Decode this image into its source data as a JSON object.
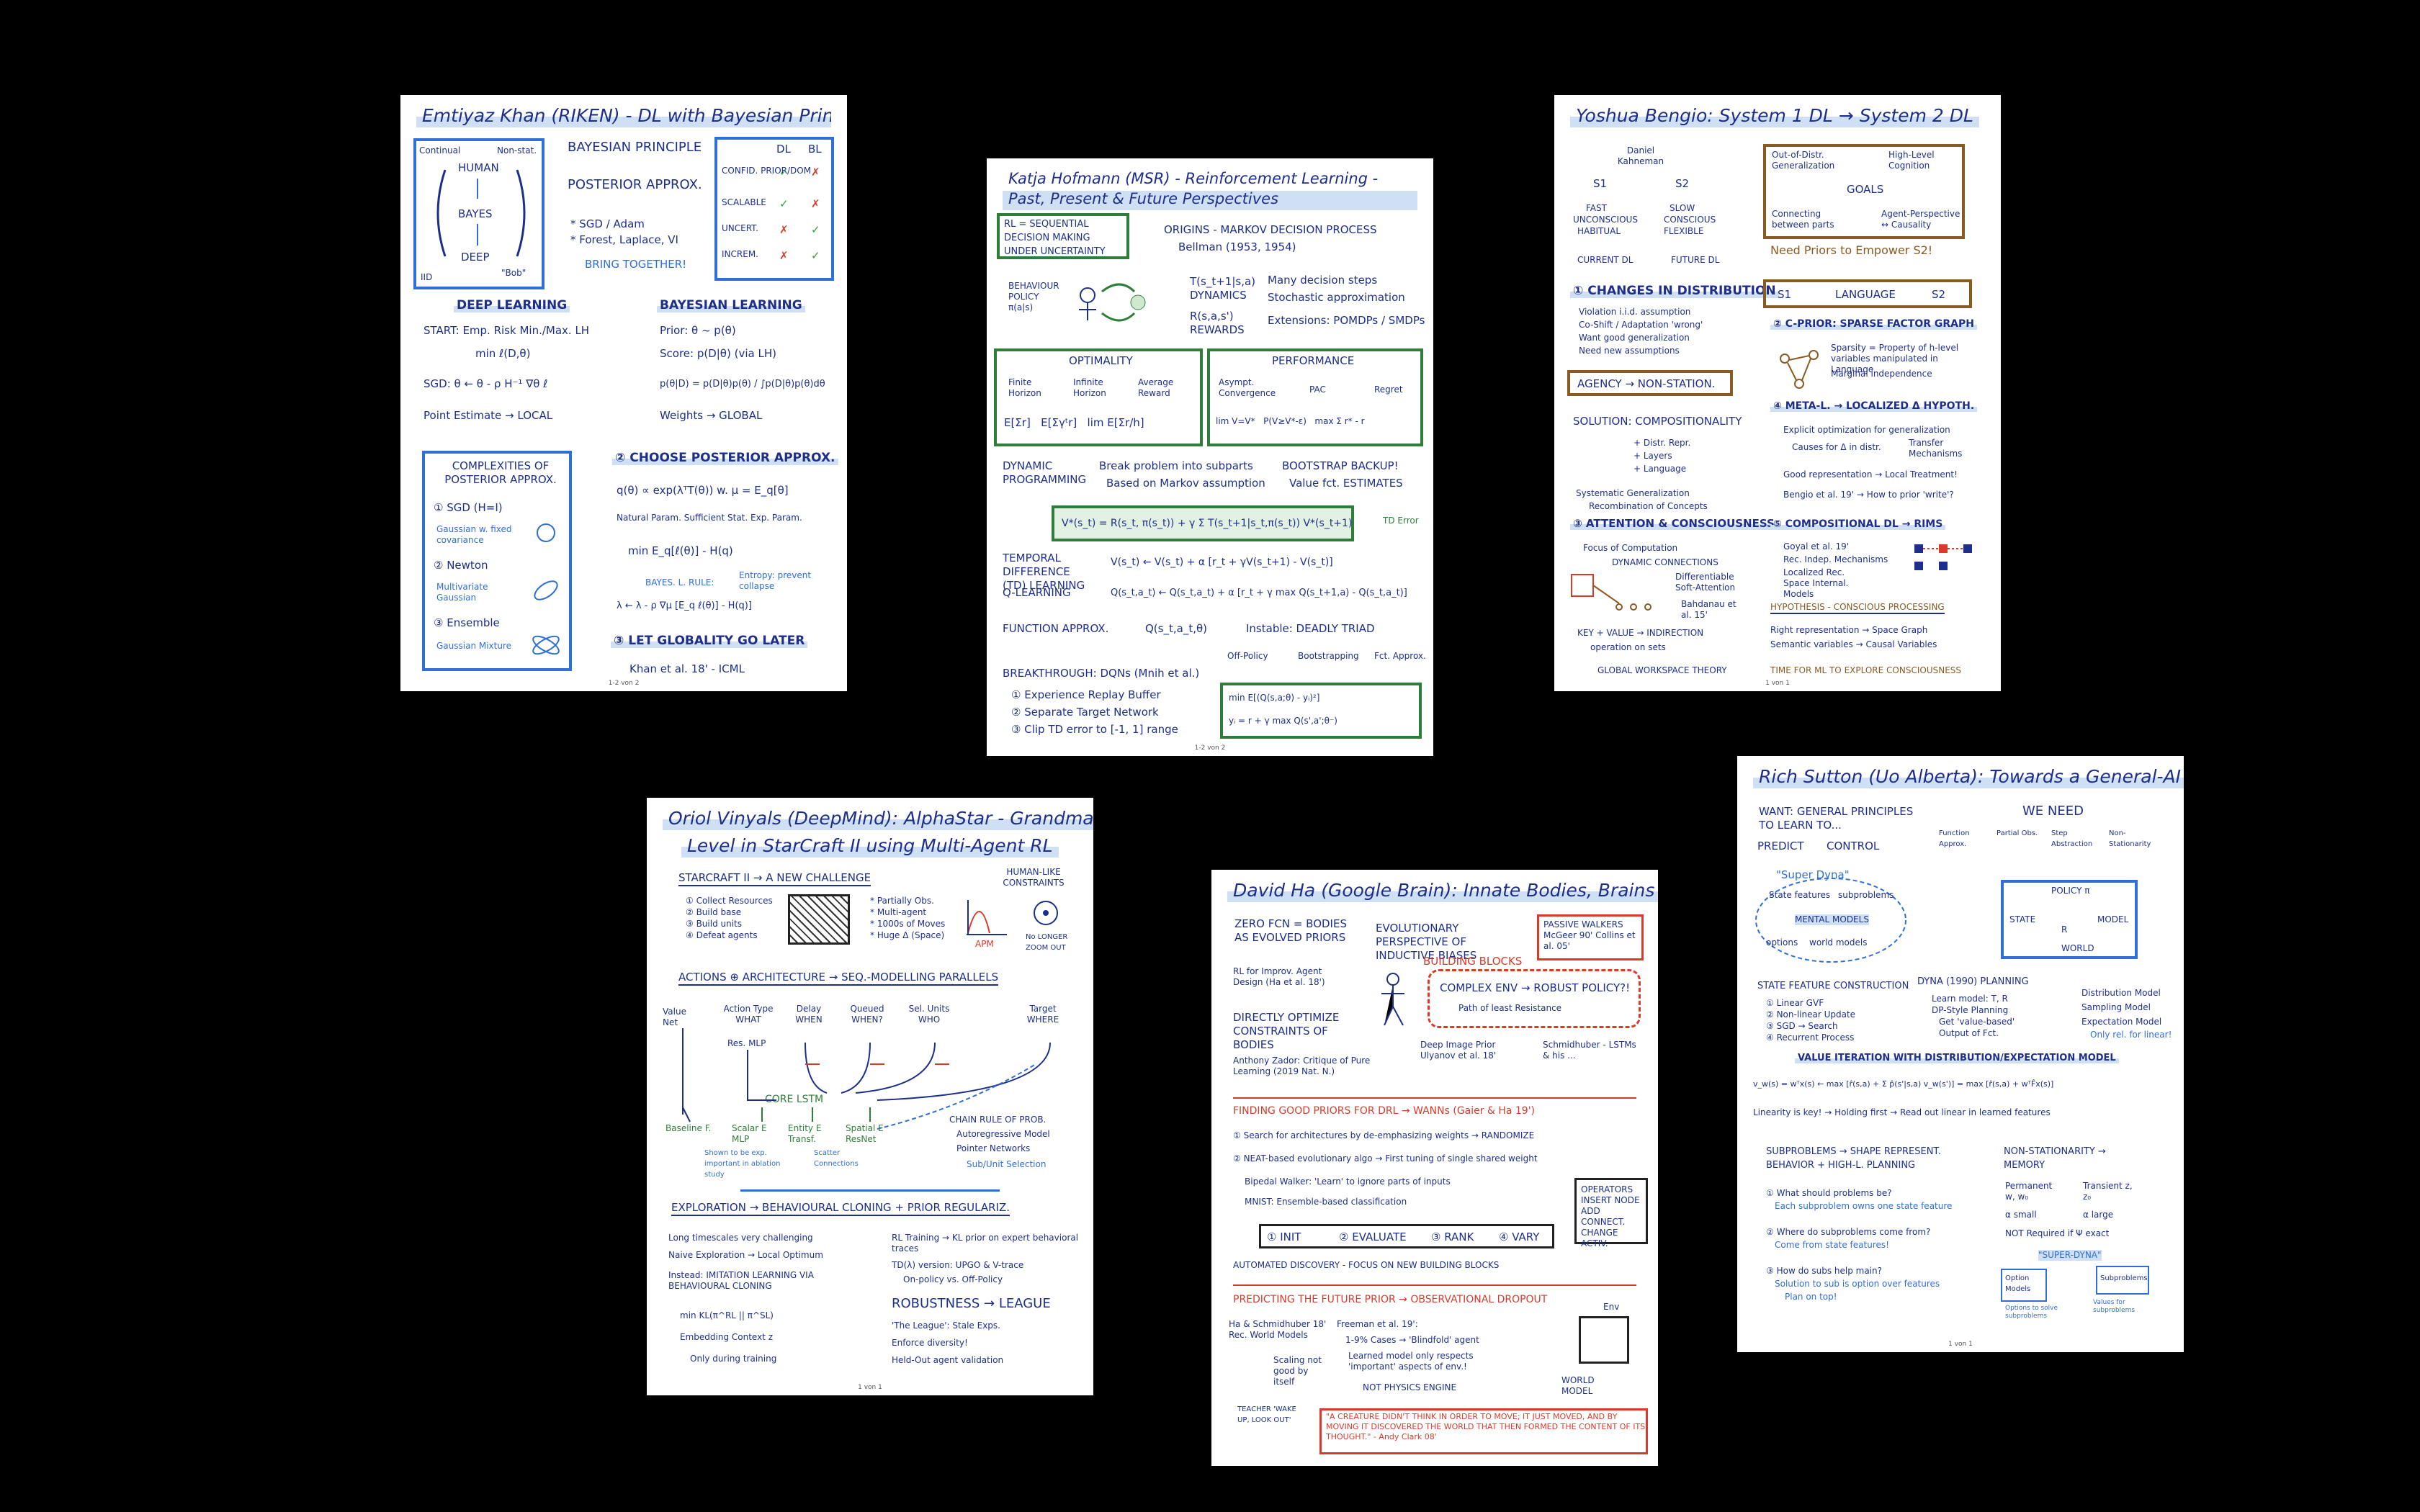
{
  "pages": {
    "khan": {
      "title": "Emtiyaz Khan (RIKEN) - DL with Bayesian Principles",
      "diagram": {
        "human": "HUMAN",
        "bayes": "BAYES",
        "deep": "DEEP",
        "top_left": "Continual",
        "top_right": "Non-stat.",
        "bottom_left": "IID",
        "bottom_right": "\"Bob\""
      },
      "principle": {
        "line1": "BAYESIAN PRINCIPLE",
        "line2": "POSTERIOR APPROX.",
        "line3": "* SGD / Adam",
        "line4": "* Forest, Laplace, VI",
        "line5": "BRING TOGETHER!"
      },
      "table": {
        "head_dl": "DL",
        "head_bl": "BL",
        "rows": [
          "CONFID. PRIOR/DOM",
          "SCALABLE",
          "UNCERT.",
          "INCREM."
        ]
      },
      "deep_learning": {
        "heading": "DEEP LEARNING",
        "l1": "START: Emp. Risk Min./Max. LH",
        "l2": "min ℓ(D,θ)",
        "l3": "SGD: θ ← θ - ρ H⁻¹ ∇θ ℓ",
        "l4": "Point Estimate → LOCAL"
      },
      "bayesian_learning": {
        "heading": "BAYESIAN LEARNING",
        "l1": "Prior: θ ~ p(θ)",
        "l2": "Score: p(D|θ) (via LH)",
        "l3": "p(θ|D) = p(D|θ)p(θ) / ∫p(D|θ)p(θ)dθ",
        "l4": "Weights → GLOBAL"
      },
      "complexities": {
        "heading": "COMPLEXITIES OF POSTERIOR APPROX.",
        "i1": "① SGD (H=I)",
        "i1b": "Gaussian w. fixed covariance",
        "i2": "② Newton",
        "i2b": "Multivariate Gaussian",
        "i3": "③ Ensemble",
        "i3b": "Gaussian Mixture"
      },
      "choose": {
        "heading": "② CHOOSE POSTERIOR APPROX.",
        "l1": "q(θ) ∝ exp(λᵀT(θ)) w. μ = E_q[θ]",
        "l2": "Natural Param. Sufficient Stat. Exp. Param.",
        "l3": "min E_q[ℓ(θ)] - H(q)",
        "l4": "BAYES. L. RULE:",
        "l5": "λ ← λ - ρ ∇μ [E_q ℓ(θ)] - H(q)]",
        "l6": "Entropy: prevent collapse",
        "l7": "③ LET GLOBALITY GO LATER",
        "l8": "Khan et al. 18' - ICML"
      },
      "page_no": "1-2 von 2"
    },
    "hofmann": {
      "title": "Katja Hofmann (MSR) - Reinforcement Learning - Past, Present & Future Perspectives",
      "rl_box": "RL = SEQUENTIAL DECISION MAKING UNDER UNCERTAINTY",
      "origins": {
        "l1": "ORIGINS - MARKOV DECISION PROCESS",
        "l2": "Bellman (1953, 1954)"
      },
      "mdp": {
        "l1": "T(s_t+1|s,a) DYNAMICS",
        "l2": "R(s,a,s') REWARDS",
        "l3": "Many decision steps",
        "l4": "Stochastic approximation",
        "l5": "Extensions: POMDPs / SMDPs",
        "policy": "BEHAVIOUR POLICY π(a|s)"
      },
      "optimality": {
        "heading": "OPTIMALITY",
        "c1": "Finite Horizon",
        "c2": "Infinite Horizon",
        "c3": "Average Reward"
      },
      "performance": {
        "heading": "PERFORMANCE",
        "c1": "Asympt. Convergence",
        "c2": "PAC",
        "c3": "Regret"
      },
      "dynamic": {
        "l1": "DYNAMIC PROGRAMMING",
        "l2": "Break problem into subparts",
        "l3": "Based on Markov assumption",
        "l4": "BOOTSTRAP BACKUP!",
        "l5": "Value fct. ESTIMATES"
      },
      "bellman": "V*(s_t) = R(s_t, π(s_t)) + γ Σ T(s_t+1|s_t,π(s_t)) V*(s_t+1)",
      "td_label": "TD Error",
      "td": {
        "l1": "TEMPORAL DIFFERENCE (TD) LEARNING",
        "l2": "V(s_t) ← V(s_t) + α [r_t + γV(s_t+1) - V(s_t)]"
      },
      "q": {
        "l1": "Q-LEARNING",
        "l2": "Q(s_t,a_t) ← Q(s_t,a_t) + α [r_t + γ max Q(s_t+1,a) - Q(s_t,a_t)]"
      },
      "fa": {
        "l1": "FUNCTION APPROX.",
        "l2": "Q(s_t,a_t,θ)",
        "l3": "Instable: DEADLY TRIAD",
        "l4": "Off-Policy",
        "l5": "Bootstrapping",
        "l6": "Fct. Approx."
      },
      "breakthrough": {
        "l1": "BREAKTHROUGH: DQNs (Mnih et al.)",
        "l2": "① Experience Replay Buffer",
        "l3": "② Separate Target Network",
        "l4": "③ Clip TD error to [-1, 1] range",
        "loss": "min E[(Q(s,a;θ) - yᵢ)²]",
        "target": "yᵢ = r + γ max Q(s',a';θ⁻)"
      },
      "page_no": "1-2 von 2"
    },
    "bengio": {
      "title": "Yoshua Bengio: System 1 DL → System 2 DL",
      "kahneman": "Daniel Kahneman",
      "s1": {
        "h": "S1",
        "l1": "FAST",
        "l2": "UNCONSCIOUS",
        "l3": "HABITUAL",
        "l4": "CURRENT DL"
      },
      "s2": {
        "h": "S2",
        "l1": "SLOW",
        "l2": "CONSCIOUS",
        "l3": "FLEXIBLE",
        "l4": "FUTURE DL"
      },
      "goals": {
        "h": "GOALS",
        "a": "Out-of-Distr. Generalization",
        "b": "High-Level Cognition",
        "c": "Connecting between parts",
        "d": "Agent-Perspective ↔ Causality"
      },
      "need_priors": "Need Priors to Empower S2!",
      "lang": {
        "a": "S1",
        "b": "LANGUAGE",
        "c": "S2"
      },
      "changes": {
        "h": "① CHANGES IN DISTRIBUTION",
        "l1": "Violation i.i.d. assumption",
        "l2": "Co-Shift / Adaptation 'wrong'",
        "l3": "Want good generalization",
        "l4": "Need new assumptions"
      },
      "agency": "AGENCY → NON-STATION.",
      "solution": {
        "h": "SOLUTION: COMPOSITIONALITY",
        "l1": "+ Distr. Repr.",
        "l2": "+ Layers",
        "l3": "+ Language",
        "l4": "Systematic Generalization",
        "l5": "Recombination of Concepts"
      },
      "graph": {
        "h": "② C-PRIOR: SPARSE FACTOR GRAPH",
        "l1": "Sparsity = Property of h-level variables manipulated in Language",
        "l2": "Marginal independence"
      },
      "meta": {
        "h": "④ META-L. → LOCALIZED Δ HYPOTH.",
        "l1": "Explicit optimization for generalization",
        "l2": "Causes for Δ in distr.",
        "l3": "Transfer Mechanisms",
        "l4": "Good representation → Local Treatment!",
        "l5": "Bengio et al. 19' → How to prior 'write'?"
      },
      "attention": {
        "h": "③ ATTENTION & CONSCIOUSNESS",
        "l1": "Focus of Computation",
        "l2": "DYNAMIC CONNECTIONS",
        "l3": "Differentiable Soft-Attention",
        "l4": "Bahdanau et al. 15'",
        "l5": "KEY + VALUE → INDIRECTION",
        "l6": "operation on sets"
      },
      "comp": {
        "h": "⑤ COMPOSITIONAL DL → RIMS",
        "l1": "Goyal et al. 19'",
        "l2": "Rec. Indep. Mechanisms",
        "l3": "Localized Rec. Space Internal. Models"
      },
      "hyp": {
        "h": "HYPOTHESIS - CONSCIOUS PROCESSING",
        "l1": "Right representation → Space Graph",
        "l2": "Semantic variables → Causal Variables"
      },
      "gwt": "GLOBAL WORKSPACE THEORY",
      "time": "TIME FOR ML TO EXPLORE CONSCIOUSNESS",
      "page_no": "1 von 1"
    },
    "vinyals": {
      "title1": "Oriol Vinyals (DeepMind): AlphaStar - Grandmaster",
      "title2": "Level in StarCraft II using Multi-Agent RL",
      "challenge": {
        "h": "STARCRAFT II → A NEW CHALLENGE",
        "l1": "① Collect Resources",
        "l2": "② Build base",
        "l3": "③ Build units",
        "l4": "④ Defeat agents",
        "r1": "* Partially Obs.",
        "r2": "* Multi-agent",
        "r3": "* 1000s of Moves",
        "r4": "* Huge Δ (Space)",
        "hl": "HUMAN-LIKE CONSTRAINTS",
        "apm": "APM",
        "hl2": "No LONGER ZOOM OUT"
      },
      "arch": {
        "h": "ACTIONS ⊕ ARCHITECTURE → SEQ.-MODELLING PARALLELS",
        "c1": "Value Net",
        "c2": "Action Type WHAT",
        "c3": "Delay WHEN",
        "c4": "Queued WHEN?",
        "c5": "Sel. Units WHO",
        "c6": "Target WHERE",
        "mlp": "Res. MLP",
        "core": "CORE LSTM",
        "base": "Baseline F.",
        "scalar": "Scalar E MLP",
        "entity": "Entity E Transf.",
        "spatial": "Spatial E ResNet",
        "skip": "Scatter Connections",
        "shown": "Shown to be exp. important in ablation study",
        "chain": "CHAIN RULE OF PROB.",
        "ar": "Autoregressive Model",
        "ptr": "Pointer Networks",
        "sub": "Sub/Unit Selection"
      },
      "explore": {
        "h": "EXPLORATION → BEHAVIOURAL CLONING + PRIOR REGULARIZ.",
        "l1": "Long timescales very challenging",
        "l2": "Naive Exploration → Local Optimum",
        "l3": "Instead: IMITATION LEARNING VIA BEHAVIOURAL CLONING",
        "l4": "min KL(π^RL || π^SL)",
        "l5": "Embedding Context z",
        "l6": "Only during training",
        "r1": "RL Training → KL prior on expert behavioral traces",
        "r2": "TD(λ) version: UPGO & V-trace",
        "r3": "On-policy vs. Off-Policy"
      },
      "robust": {
        "h": "ROBUSTNESS → LEAGUE",
        "l1": "'The League': Stale Exps.",
        "l2": "Enforce diversity!",
        "l3": "Held-Out agent validation"
      },
      "page_no": "1 von 1"
    },
    "ha": {
      "title": "David Ha (Google Brain): Innate Bodies, Brains & Minds",
      "l1": "ZERO FCN = BODIES AS EVOLVED PRIORS",
      "l2": "EVOLUTIONARY PERSPECTIVE OF INDUCTIVE BIASES",
      "l3": "BUILDING BLOCKS",
      "passive": "PASSIVE WALKERS McGeer 90' Collins et al. 05'",
      "l4": "RL for Improv. Agent Design (Ha et al. 18')",
      "l5": "DIRECTLY OPTIMIZE CONSTRAINTS OF BODIES",
      "l6": "COMPLEX ENV → ROBUST POLICY?!",
      "l7": "Path of least Resistance",
      "l8": "Anthony Zador: Critique of Pure Learning (2019 Nat. N.)",
      "l9": "Deep Image Prior Ulyanov et al. 18'",
      "l10": "Schmidhuber - LSTMs & his ...",
      "priors": {
        "h": "FINDING GOOD PRIORS FOR DRL → WANNs (Gaier & Ha 19')",
        "l1": "① Search for architectures by de-emphasizing weights → RANDOMIZE",
        "l2": "② NEAT-based evolutionary algo → First tuning of single shared weight",
        "l3": "Bipedal Walker: 'Learn' to ignore parts of inputs",
        "l4": "MNIST: Ensemble-based classification",
        "s1": "① INIT",
        "s2": "② EVALUATE",
        "s3": "③ RANK",
        "s4": "④ VARY",
        "ops": "OPERATORS INSERT NODE ADD CONNECT. CHANGE ACTIV.",
        "auto": "AUTOMATED DISCOVERY - FOCUS ON NEW BUILDING BLOCKS"
      },
      "future": {
        "h": "PREDICTING THE FUTURE PRIOR → OBSERVATIONAL DROPOUT",
        "l1": "Ha & Schmidhuber 18' Rec. World Models",
        "l2": "Freeman et al. 19':",
        "l3": "1-9% Cases → 'Blindfold' agent",
        "l4": "Learned model only respects 'important' aspects of env.!",
        "l5": "NOT PHYSICS ENGINE",
        "l6": "Scaling not good by itself",
        "env": "Env",
        "wm": "WORLD MODEL",
        "teacher": "TEACHER 'WAKE UP, LOOK OUT'"
      },
      "quote": "\"A CREATURE DIDN'T THINK IN ORDER TO MOVE; IT JUST MOVED, AND BY MOVING IT DISCOVERED THE WORLD THAT THEN FORMED THE CONTENT OF ITS THOUGHT.\" - Andy Clark 08'"
    },
    "sutton": {
      "title": "Rich Sutton (Uo Alberta): Towards a General-AI Architecture",
      "want": {
        "h": "WANT: GENERAL PRINCIPLES TO LEARN TO...",
        "a": "PREDICT",
        "b": "CONTROL"
      },
      "need": {
        "h": "WE NEED",
        "a": "Function Approx.",
        "b": "Partial Obs.",
        "c": "Step Abstraction",
        "d": "Non-Stationarity"
      },
      "dyna": {
        "h": "\"Super Dyna\"",
        "a": "State features",
        "b": "subproblems",
        "c": "MENTAL MODELS",
        "d": "options",
        "e": "world models"
      },
      "loop": {
        "a": "POLICY π",
        "b": "STATE",
        "c": "R",
        "d": "WORLD",
        "e": "MODEL"
      },
      "sfc": {
        "h": "STATE FEATURE CONSTRUCTION",
        "l1": "① Linear GVF",
        "l2": "② Non-linear Update",
        "l3": "③ SGD → Search",
        "l4": "④ Recurrent Process"
      },
      "dyna_planning": {
        "h": "DYNA (1990) PLANNING",
        "l1": "Learn model: T, R",
        "l2": "DP-Style Planning",
        "l3": "Get 'value-based'",
        "l4": "Output of Fct.",
        "r1": "Distribution Model",
        "r2": "Sampling Model",
        "r3": "Expectation Model",
        "r4": "Only rel. for linear!"
      },
      "vi": {
        "h": "VALUE ITERATION WITH DISTRIBUTION/EXPECTATION MODEL",
        "l1": "v_w(s) = wᵀx(s) ← max [r̂(s,a) + Σ p̂(s'|s,a) v_w(s')] = max [r̂(s,a) + wᵀF̂x(s)]",
        "l2": "Linearity is key! → Holding first → Read out linear in learned features"
      },
      "sub": {
        "h": "SUBPROBLEMS → SHAPE REPRESENT. BEHAVIOR + HIGH-L. PLANNING",
        "l1": "① What should problems be?",
        "l2": "Each subproblem owns one state feature",
        "l3": "② Where do subproblems come from?",
        "l4": "Come from state features!",
        "l5": "③ How do subs help main?",
        "l6": "Solution to sub is option over features",
        "l7": "Plan on top!"
      },
      "ns": {
        "h": "NON-STATIONARITY → MEMORY",
        "l1": "Permanent w, w₀",
        "l2": "Transient z, z₀",
        "l3": "α small",
        "l4": "α large",
        "l5": "NOT Required if Ψ exact"
      },
      "sd": {
        "h": "\"SUPER-DYNA\"",
        "a": "Option Models",
        "b": "Subproblems",
        "c": "Options to solve subproblems",
        "d": "Values for subproblems"
      },
      "page_no": "1 von 1"
    }
  }
}
